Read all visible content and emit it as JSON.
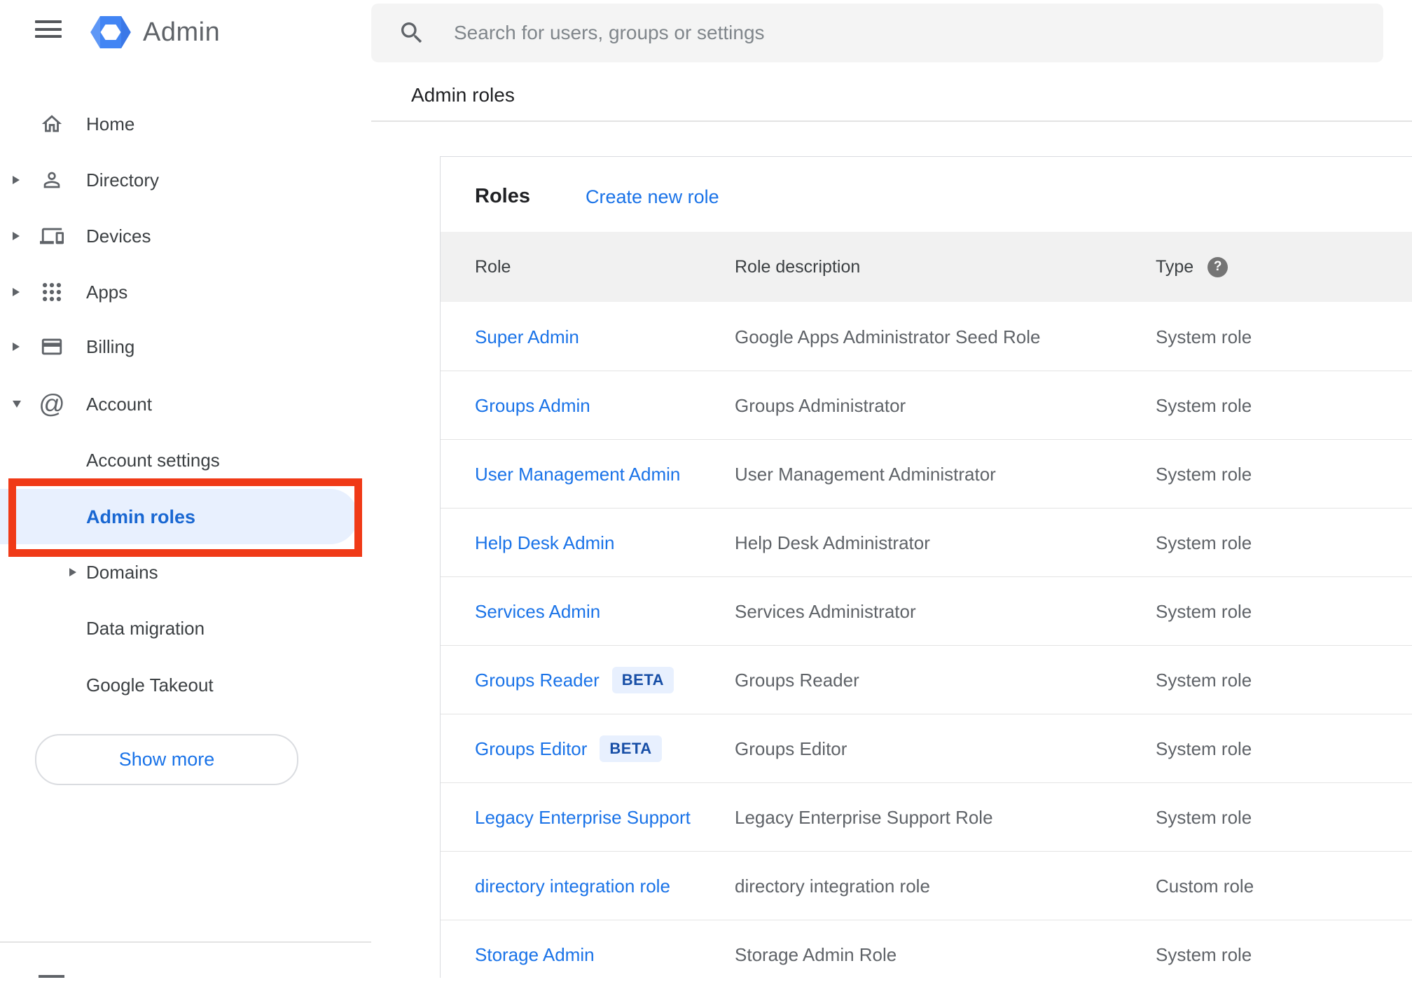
{
  "header": {
    "app_title": "Admin",
    "search_placeholder": "Search for users, groups or settings"
  },
  "breadcrumb": {
    "label": "Admin roles"
  },
  "sidebar": {
    "items": [
      {
        "label": "Home",
        "icon": "home-icon",
        "expandable": false
      },
      {
        "label": "Directory",
        "icon": "person-icon",
        "expandable": true
      },
      {
        "label": "Devices",
        "icon": "devices-icon",
        "expandable": true
      },
      {
        "label": "Apps",
        "icon": "apps-grid-icon",
        "expandable": true
      },
      {
        "label": "Billing",
        "icon": "credit-card-icon",
        "expandable": true
      },
      {
        "label": "Account",
        "icon": "at-sign-icon",
        "expandable": true,
        "expanded": true
      }
    ],
    "account_children": [
      {
        "label": "Account settings"
      },
      {
        "label": "Admin roles",
        "selected": true,
        "annotated": true
      },
      {
        "label": "Domains",
        "expandable": true
      },
      {
        "label": "Data migration"
      },
      {
        "label": "Google Takeout"
      }
    ],
    "show_more_label": "Show more"
  },
  "roles_card": {
    "title": "Roles",
    "create_link": "Create new role",
    "columns": [
      "Role",
      "Role description",
      "Type"
    ],
    "type_help_icon": "question-mark-help-icon",
    "rows": [
      {
        "role": "Super Admin",
        "description": "Google Apps Administrator Seed Role",
        "type": "System role"
      },
      {
        "role": "Groups Admin",
        "description": "Groups Administrator",
        "type": "System role"
      },
      {
        "role": "User Management Admin",
        "description": "User Management Administrator",
        "type": "System role"
      },
      {
        "role": "Help Desk Admin",
        "description": "Help Desk Administrator",
        "type": "System role"
      },
      {
        "role": "Services Admin",
        "description": "Services Administrator",
        "type": "System role"
      },
      {
        "role": "Groups Reader",
        "badge": "BETA",
        "description": "Groups Reader",
        "type": "System role"
      },
      {
        "role": "Groups Editor",
        "badge": "BETA",
        "description": "Groups Editor",
        "type": "System role"
      },
      {
        "role": "Legacy Enterprise Support",
        "description": "Legacy Enterprise Support Role",
        "type": "System role"
      },
      {
        "role": "directory integration role",
        "description": "directory integration role",
        "type": "Custom role"
      },
      {
        "role": "Storage Admin",
        "description": "Storage Admin Role",
        "type": "System role"
      }
    ]
  },
  "colors": {
    "link_blue": "#1a73e8",
    "selected_item_text": "#1967d2",
    "selected_item_bg": "#e8f0fe",
    "annotation_red": "#f03a17",
    "badge_bg": "#e8f0fe",
    "badge_text": "#174ea6",
    "table_header_bg": "#f1f1f1",
    "logo_blue": "#4285f4"
  }
}
